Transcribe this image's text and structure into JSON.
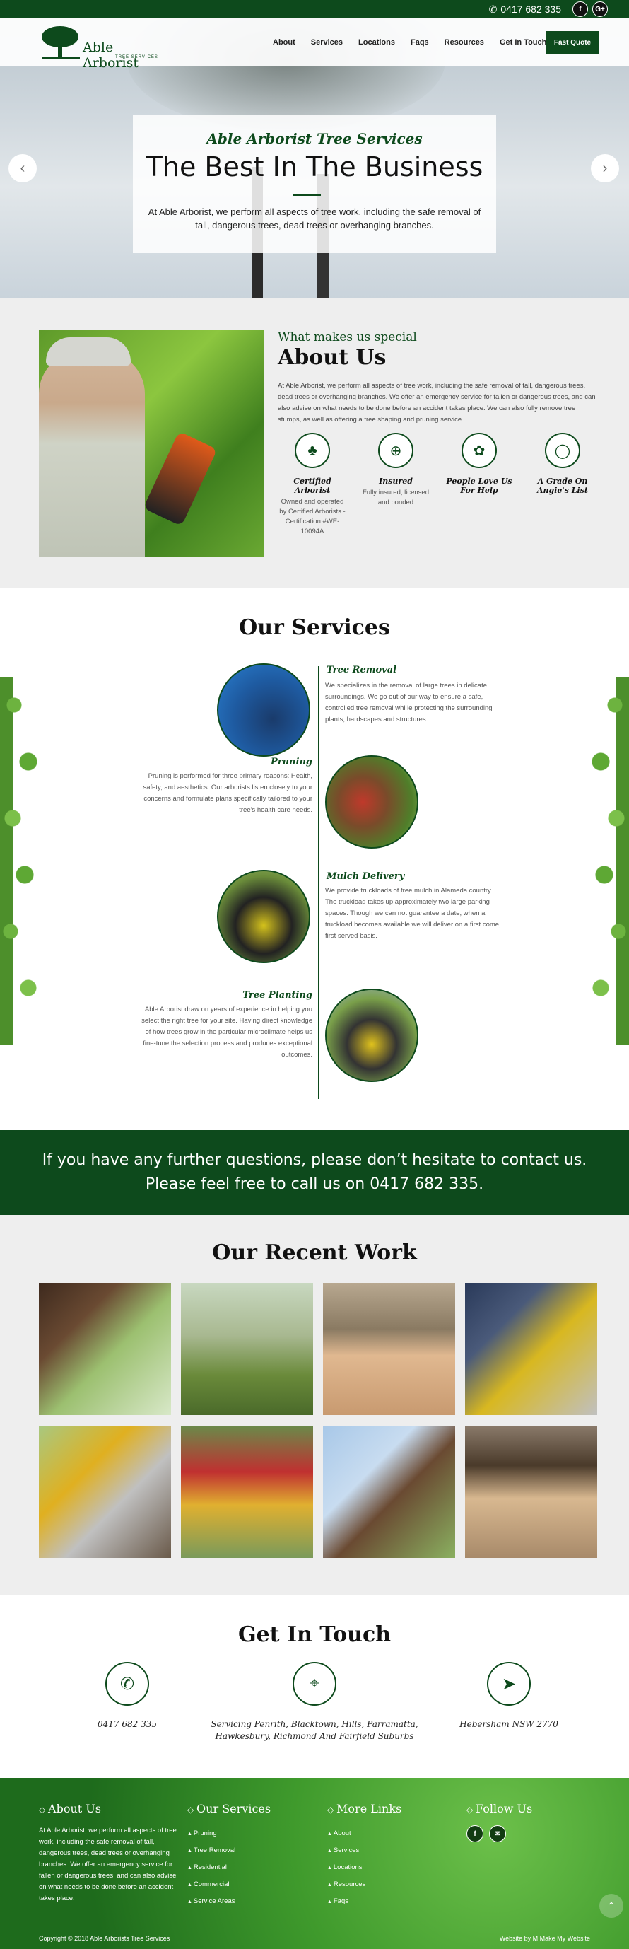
{
  "topbar": {
    "phone": "0417 682 335",
    "facebook": "f",
    "google": "G+"
  },
  "header": {
    "logo_name": "Able Arborist",
    "logo_sub": "TREE SERVICES",
    "nav": [
      "About",
      "Services",
      "Locations",
      "Faqs",
      "Resources",
      "Get In Touch"
    ],
    "quote_button": "Fast Quote"
  },
  "hero": {
    "kicker": "Able Arborist Tree Services",
    "title": "The Best In The Business",
    "text": "At Able Arborist, we perform all aspects of tree work, including the safe removal of tall, dangerous trees, dead trees or overhanging branches.",
    "prev": "‹",
    "next": "›"
  },
  "about": {
    "kicker": "What makes us special",
    "title": "About Us",
    "text": "At Able Arborist, we perform all aspects of tree work, including the safe removal of tall, dangerous trees, dead trees or overhanging branches. We offer an emergency service for fallen or dangerous trees, and can also advise on what needs to be done before an accident takes place. We can also fully remove tree stumps, as well as offering a tree shaping and pruning service.",
    "features": [
      {
        "title": "Certified Arborist",
        "text": "Owned and operated by Certified Arborists - Certification #WE-10094A"
      },
      {
        "title": "Insured",
        "text": "Fully insured, licensed and bonded"
      },
      {
        "title": "People Love Us For Help",
        "text": ""
      },
      {
        "title": "A Grade On Angie's List",
        "text": ""
      }
    ]
  },
  "services": {
    "title": "Our Services",
    "items": [
      {
        "title": "Tree Removal",
        "text": "We specializes in the removal of large trees in delicate surroundings. We go out of our way to ensure a safe, controlled tree removal whi le protecting the surrounding plants, hardscapes and structures."
      },
      {
        "title": "Pruning",
        "text": "Pruning is performed for three primary reasons: Health, safety, and aesthetics. Our arborists listen closely to your concerns and formulate plans specifically tailored to your tree's health care needs."
      },
      {
        "title": "Mulch Delivery",
        "text": "We provide truckloads of free mulch in Alameda country. The truckload takes up approximately two large parking spaces. Though we can not guarantee a date, when a truckload becomes available we will deliver on a first come, first served basis."
      },
      {
        "title": "Tree Planting",
        "text": "Able Arborist draw on years of experience in helping you select the right tree for your site. Having direct knowledge of how trees grow in the particular microclimate helps us fine-tune the selection process and produces exceptional outcomes."
      }
    ]
  },
  "cta": {
    "text": "If you have any further questions, please don’t hesitate to contact us. Please feel free to call us on 0417 682 335."
  },
  "work": {
    "title": "Our Recent Work"
  },
  "contact": {
    "title": "Get In Touch",
    "phone": "0417 682 335",
    "areas": "Servicing Penrith, Blacktown, Hills, Parramatta, Hawkesbury, Richmond And Fairfield Suburbs",
    "address": "Hebersham NSW 2770"
  },
  "footer": {
    "about_title": "About Us",
    "about_text": "At Able Arborist, we perform all aspects of tree work, including the safe removal of tall, dangerous trees, dead trees or overhanging branches. We offer an emergency service for fallen or dangerous trees, and can also advise on what needs to be done before an accident takes place.",
    "services_title": "Our Services",
    "services": [
      "Pruning",
      "Tree Removal",
      "Residential",
      "Commercial",
      "Service Areas"
    ],
    "links_title": "More Links",
    "links": [
      "About",
      "Services",
      "Locations",
      "Resources",
      "Faqs"
    ],
    "follow_title": "Follow Us",
    "copyright": "Copyright © 2018 Able Arborists Tree Services",
    "credit": "Website by  M  Make My Website"
  },
  "colors": {
    "brand_green": "#0d4a1c",
    "bg_gray": "#eeeeee"
  }
}
